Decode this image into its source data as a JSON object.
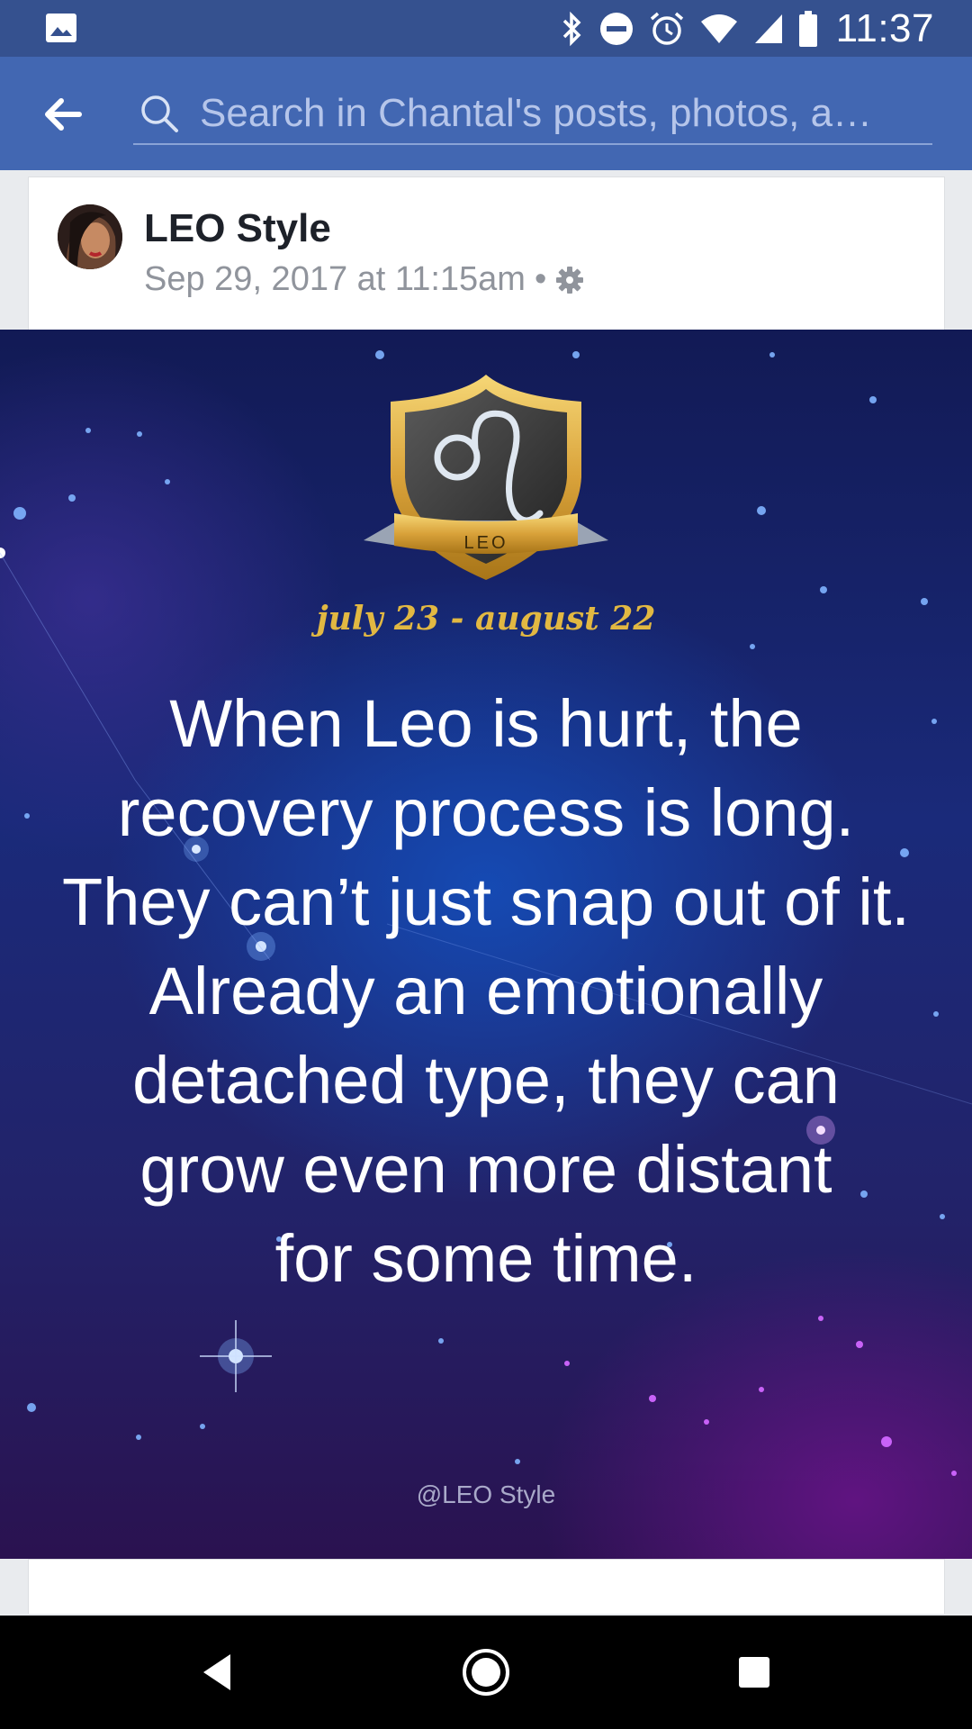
{
  "status_bar": {
    "time": "11:37",
    "icons": [
      "gallery-icon",
      "bluetooth-icon",
      "do-not-disturb-icon",
      "alarm-icon",
      "wifi-icon",
      "signal-icon",
      "battery-icon"
    ]
  },
  "app_bar": {
    "back_icon": "arrow-back-icon",
    "search_icon": "search-icon",
    "search_placeholder": "Search in Chantal's posts, photos, a…"
  },
  "post": {
    "author": "LEO Style",
    "timestamp": "Sep 29, 2017 at 11:15am",
    "separator": "•",
    "privacy_icon": "gear-icon",
    "image": {
      "badge_label": "LEO",
      "dates": "july 23 - august 22",
      "quote_lines": [
        "When Leo is hurt, the",
        "recovery process is long.",
        "They can’t just snap out of it.",
        "Already an emotionally",
        "detached type, they can",
        "grow even more distant",
        "for some time."
      ],
      "watermark": "@LEO Style"
    }
  },
  "nav_bar": {
    "icons": [
      "nav-back-icon",
      "nav-home-icon",
      "nav-recents-icon"
    ]
  },
  "colors": {
    "status_bar": "#35518f",
    "app_bar": "#4267b2",
    "date_gold": "#e2b842"
  }
}
